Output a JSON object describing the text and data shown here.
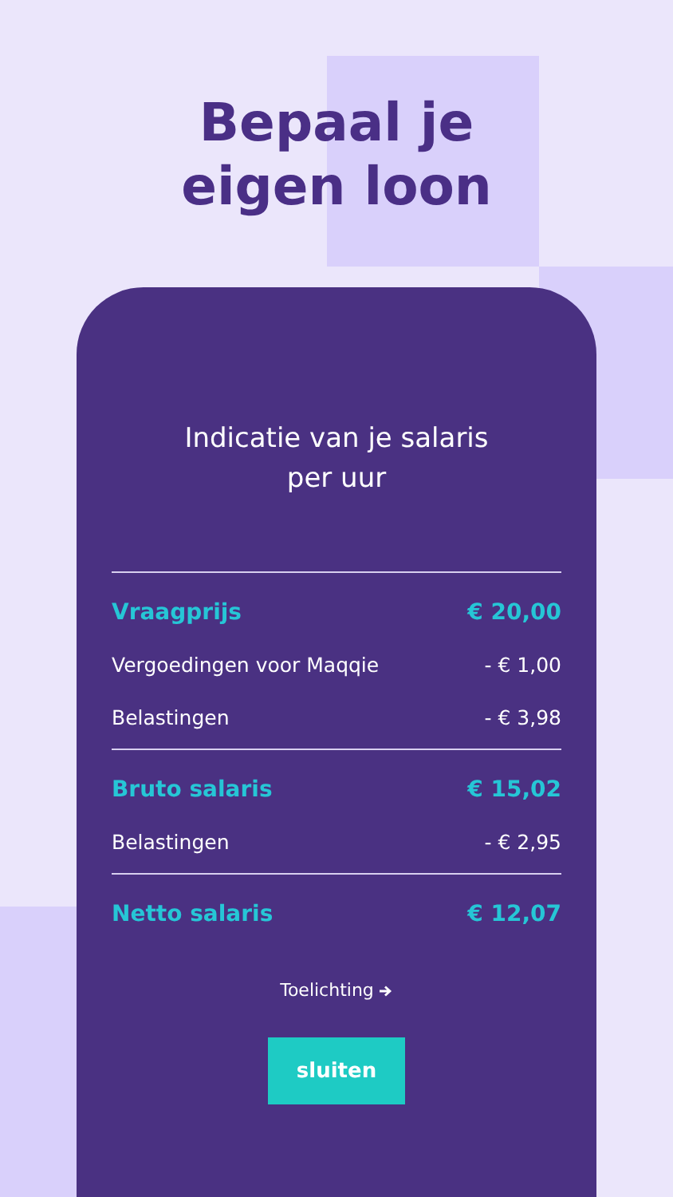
{
  "headline": "Bepaal je eigen loon",
  "screen": {
    "title": "Indicatie van je salaris per uur",
    "sections": [
      {
        "rows": [
          {
            "kind": "total",
            "label": "Vraagprijs",
            "amount": "€ 20,00"
          },
          {
            "kind": "item",
            "label": "Vergoedingen voor Maqqie",
            "amount": "- € 1,00"
          },
          {
            "kind": "item",
            "label": "Belastingen",
            "amount": "- € 3,98"
          }
        ]
      },
      {
        "rows": [
          {
            "kind": "total",
            "label": "Bruto salaris",
            "amount": "€ 15,02"
          },
          {
            "kind": "item",
            "label": "Belastingen",
            "amount": "- € 2,95"
          }
        ]
      },
      {
        "rows": [
          {
            "kind": "total",
            "label": "Netto salaris",
            "amount": "€ 12,07"
          }
        ]
      }
    ],
    "link": "Toelichting",
    "button": "sluiten"
  }
}
